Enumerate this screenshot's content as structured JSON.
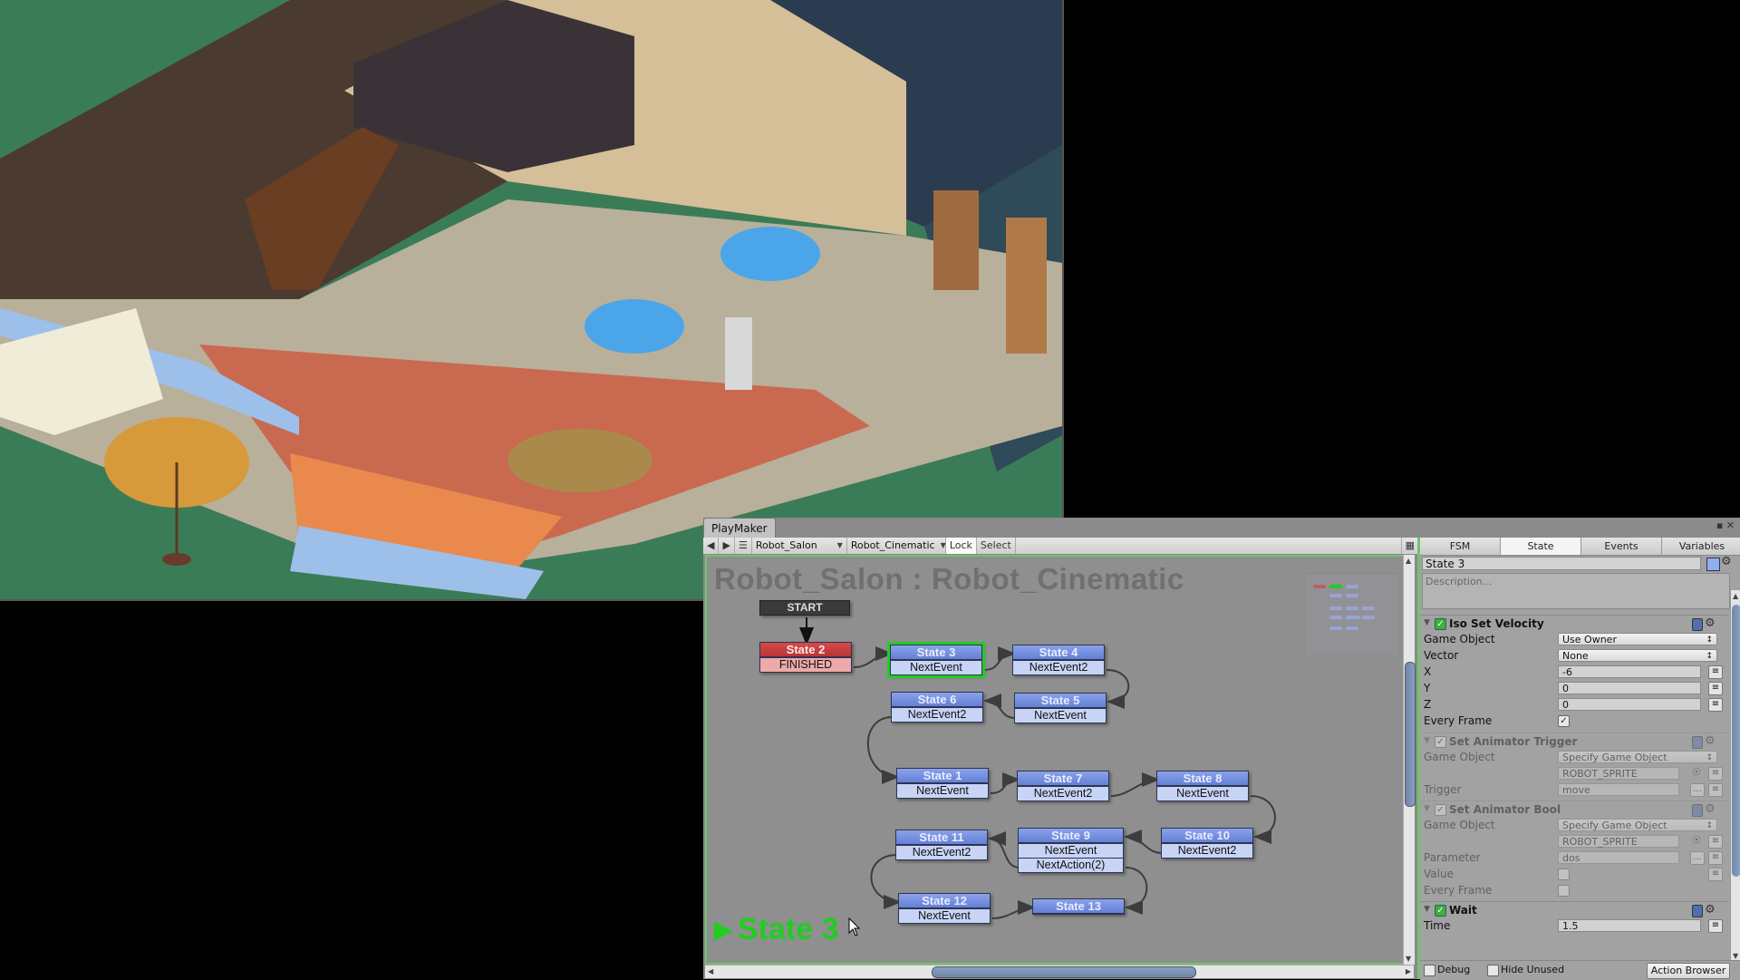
{
  "game_view": {
    "description": "Isometric cartoon salon room scene with furniture, staircase, armchairs, robot character and garden with parasol"
  },
  "playmaker": {
    "window_tab": "PlayMaker",
    "toolbar": {
      "back_icon": "arrow-left-icon",
      "forward_icon": "arrow-right-icon",
      "menu_icon": "hamburger-icon",
      "gameobject_dropdown": "Robot_Salon",
      "fsm_dropdown": "Robot_Cinematic",
      "lock_label": "Lock",
      "select_label": "Select"
    },
    "graph": {
      "title": "Robot_Salon : Robot_Cinematic",
      "start_label": "START",
      "active_state_label": "State 3",
      "states": [
        {
          "id": "s2",
          "name": "State 2",
          "events": [
            "FINISHED"
          ],
          "style": "red"
        },
        {
          "id": "s3",
          "name": "State 3",
          "events": [
            "NextEvent"
          ],
          "style": "active"
        },
        {
          "id": "s4",
          "name": "State 4",
          "events": [
            "NextEvent2"
          ]
        },
        {
          "id": "s6",
          "name": "State 6",
          "events": [
            "NextEvent2"
          ]
        },
        {
          "id": "s5",
          "name": "State 5",
          "events": [
            "NextEvent"
          ]
        },
        {
          "id": "s1",
          "name": "State 1",
          "events": [
            "NextEvent"
          ]
        },
        {
          "id": "s7",
          "name": "State 7",
          "events": [
            "NextEvent2"
          ]
        },
        {
          "id": "s8",
          "name": "State 8",
          "events": [
            "NextEvent"
          ]
        },
        {
          "id": "s11",
          "name": "State 11",
          "events": [
            "NextEvent2"
          ]
        },
        {
          "id": "s9",
          "name": "State 9",
          "events": [
            "NextEvent",
            "NextAction(2)"
          ]
        },
        {
          "id": "s10",
          "name": "State 10",
          "events": [
            "NextEvent2"
          ]
        },
        {
          "id": "s12",
          "name": "State 12",
          "events": [
            "NextEvent"
          ]
        },
        {
          "id": "s13",
          "name": "State 13",
          "events": []
        }
      ],
      "transitions": [
        [
          "start",
          "s2"
        ],
        [
          "s2",
          "s3"
        ],
        [
          "s3",
          "s4"
        ],
        [
          "s4",
          "s5"
        ],
        [
          "s5",
          "s6"
        ],
        [
          "s6",
          "s1"
        ],
        [
          "s1",
          "s7"
        ],
        [
          "s7",
          "s8"
        ],
        [
          "s8",
          "s10"
        ],
        [
          "s10",
          "s9"
        ],
        [
          "s9",
          "s11"
        ],
        [
          "s9",
          "s13"
        ],
        [
          "s11",
          "s12"
        ],
        [
          "s12",
          "s13"
        ]
      ]
    },
    "inspector": {
      "tabs": [
        "FSM",
        "State",
        "Events",
        "Variables"
      ],
      "selected_tab": "State",
      "state_name": "State 3",
      "description_placeholder": "Description...",
      "state_color": "#8fb0f0",
      "actions": [
        {
          "title": "Iso Set Velocity",
          "enabled": true,
          "fields": [
            {
              "label": "Game Object",
              "type": "dropdown",
              "value": "Use Owner"
            },
            {
              "label": "Vector",
              "type": "dropdown",
              "value": "None"
            },
            {
              "label": "X",
              "type": "text",
              "value": "-6"
            },
            {
              "label": "Y",
              "type": "text",
              "value": "0"
            },
            {
              "label": "Z",
              "type": "text",
              "value": "0"
            },
            {
              "label": "Every Frame",
              "type": "checkbox",
              "value": true
            }
          ]
        },
        {
          "title": "Set Animator Trigger",
          "enabled": false,
          "fields": [
            {
              "label": "Game Object",
              "type": "dropdown",
              "value": "Specify Game Object"
            },
            {
              "label": "",
              "type": "object",
              "value": "ROBOT_SPRITE"
            },
            {
              "label": "Trigger",
              "type": "text",
              "value": "move"
            }
          ]
        },
        {
          "title": "Set Animator Bool",
          "enabled": false,
          "fields": [
            {
              "label": "Game Object",
              "type": "dropdown",
              "value": "Specify Game Object"
            },
            {
              "label": "",
              "type": "object",
              "value": "ROBOT_SPRITE"
            },
            {
              "label": "Parameter",
              "type": "text",
              "value": "dos"
            },
            {
              "label": "Value",
              "type": "checkbox",
              "value": false
            },
            {
              "label": "Every Frame",
              "type": "checkbox",
              "value": false
            }
          ]
        },
        {
          "title": "Wait",
          "enabled": true,
          "fields": [
            {
              "label": "Time",
              "type": "text",
              "value": "1.5"
            }
          ]
        }
      ],
      "bottom": {
        "debug_label": "Debug",
        "debug_checked": false,
        "hide_unused_label": "Hide Unused",
        "hide_unused_checked": false,
        "action_browser_label": "Action Browser"
      }
    }
  }
}
